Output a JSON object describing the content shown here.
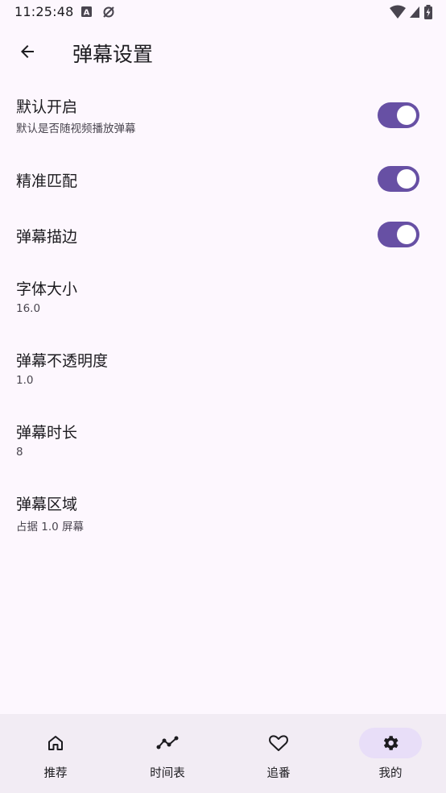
{
  "status_bar": {
    "time": "11:25:48"
  },
  "app_bar": {
    "title": "弹幕设置"
  },
  "settings": [
    {
      "title": "默认开启",
      "subtitle": "默认是否随视频播放弹幕",
      "toggle": true,
      "toggle_on": true
    },
    {
      "title": "精准匹配",
      "subtitle": "",
      "toggle": true,
      "toggle_on": true
    },
    {
      "title": "弹幕描边",
      "subtitle": "",
      "toggle": true,
      "toggle_on": true
    },
    {
      "title": "字体大小",
      "subtitle": "16.0",
      "toggle": false
    },
    {
      "title": "弹幕不透明度",
      "subtitle": "1.0",
      "toggle": false
    },
    {
      "title": "弹幕时长",
      "subtitle": "8",
      "toggle": false
    },
    {
      "title": "弹幕区域",
      "subtitle": "占据 1.0 屏幕",
      "toggle": false
    }
  ],
  "bottom_nav": {
    "items": [
      {
        "label": "推荐",
        "icon": "home-icon",
        "active": false
      },
      {
        "label": "时间表",
        "icon": "timeline-icon",
        "active": false
      },
      {
        "label": "追番",
        "icon": "heart-icon",
        "active": false
      },
      {
        "label": "我的",
        "icon": "gear-icon",
        "active": true
      }
    ]
  },
  "colors": {
    "background": "#fdf7fe",
    "accent": "#6750a4",
    "nav_background": "#f2ecf4",
    "nav_active_indicator": "#e8def8"
  }
}
